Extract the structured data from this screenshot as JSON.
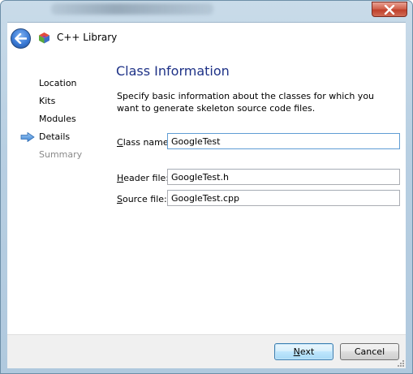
{
  "window": {
    "title": "C++ Library"
  },
  "steps": [
    {
      "label": "Location",
      "state": "done"
    },
    {
      "label": "Kits",
      "state": "done"
    },
    {
      "label": "Modules",
      "state": "done"
    },
    {
      "label": "Details",
      "state": "current"
    },
    {
      "label": "Summary",
      "state": "future"
    }
  ],
  "page": {
    "title": "Class Information",
    "description": "Specify basic information about the classes for which you want to generate skeleton source code files."
  },
  "fields": {
    "class_name": {
      "label_accel": "C",
      "label_rest": "lass name:",
      "value": "GoogleTest"
    },
    "header_file": {
      "label_accel": "H",
      "label_rest": "eader file:",
      "value": "GoogleTest.h"
    },
    "source_file": {
      "label_accel": "S",
      "label_rest": "ource file:",
      "value": "GoogleTest.cpp"
    }
  },
  "buttons": {
    "next": {
      "accel": "N",
      "rest": "ext"
    },
    "cancel": {
      "label": "Cancel"
    }
  },
  "icons": {
    "back": "back-arrow-icon",
    "app": "qt-cube-icon",
    "current_step": "step-arrow-icon",
    "close": "close-icon"
  },
  "colors": {
    "title_blue": "#1e3287",
    "current_step_arrow": "#4a90d9"
  }
}
